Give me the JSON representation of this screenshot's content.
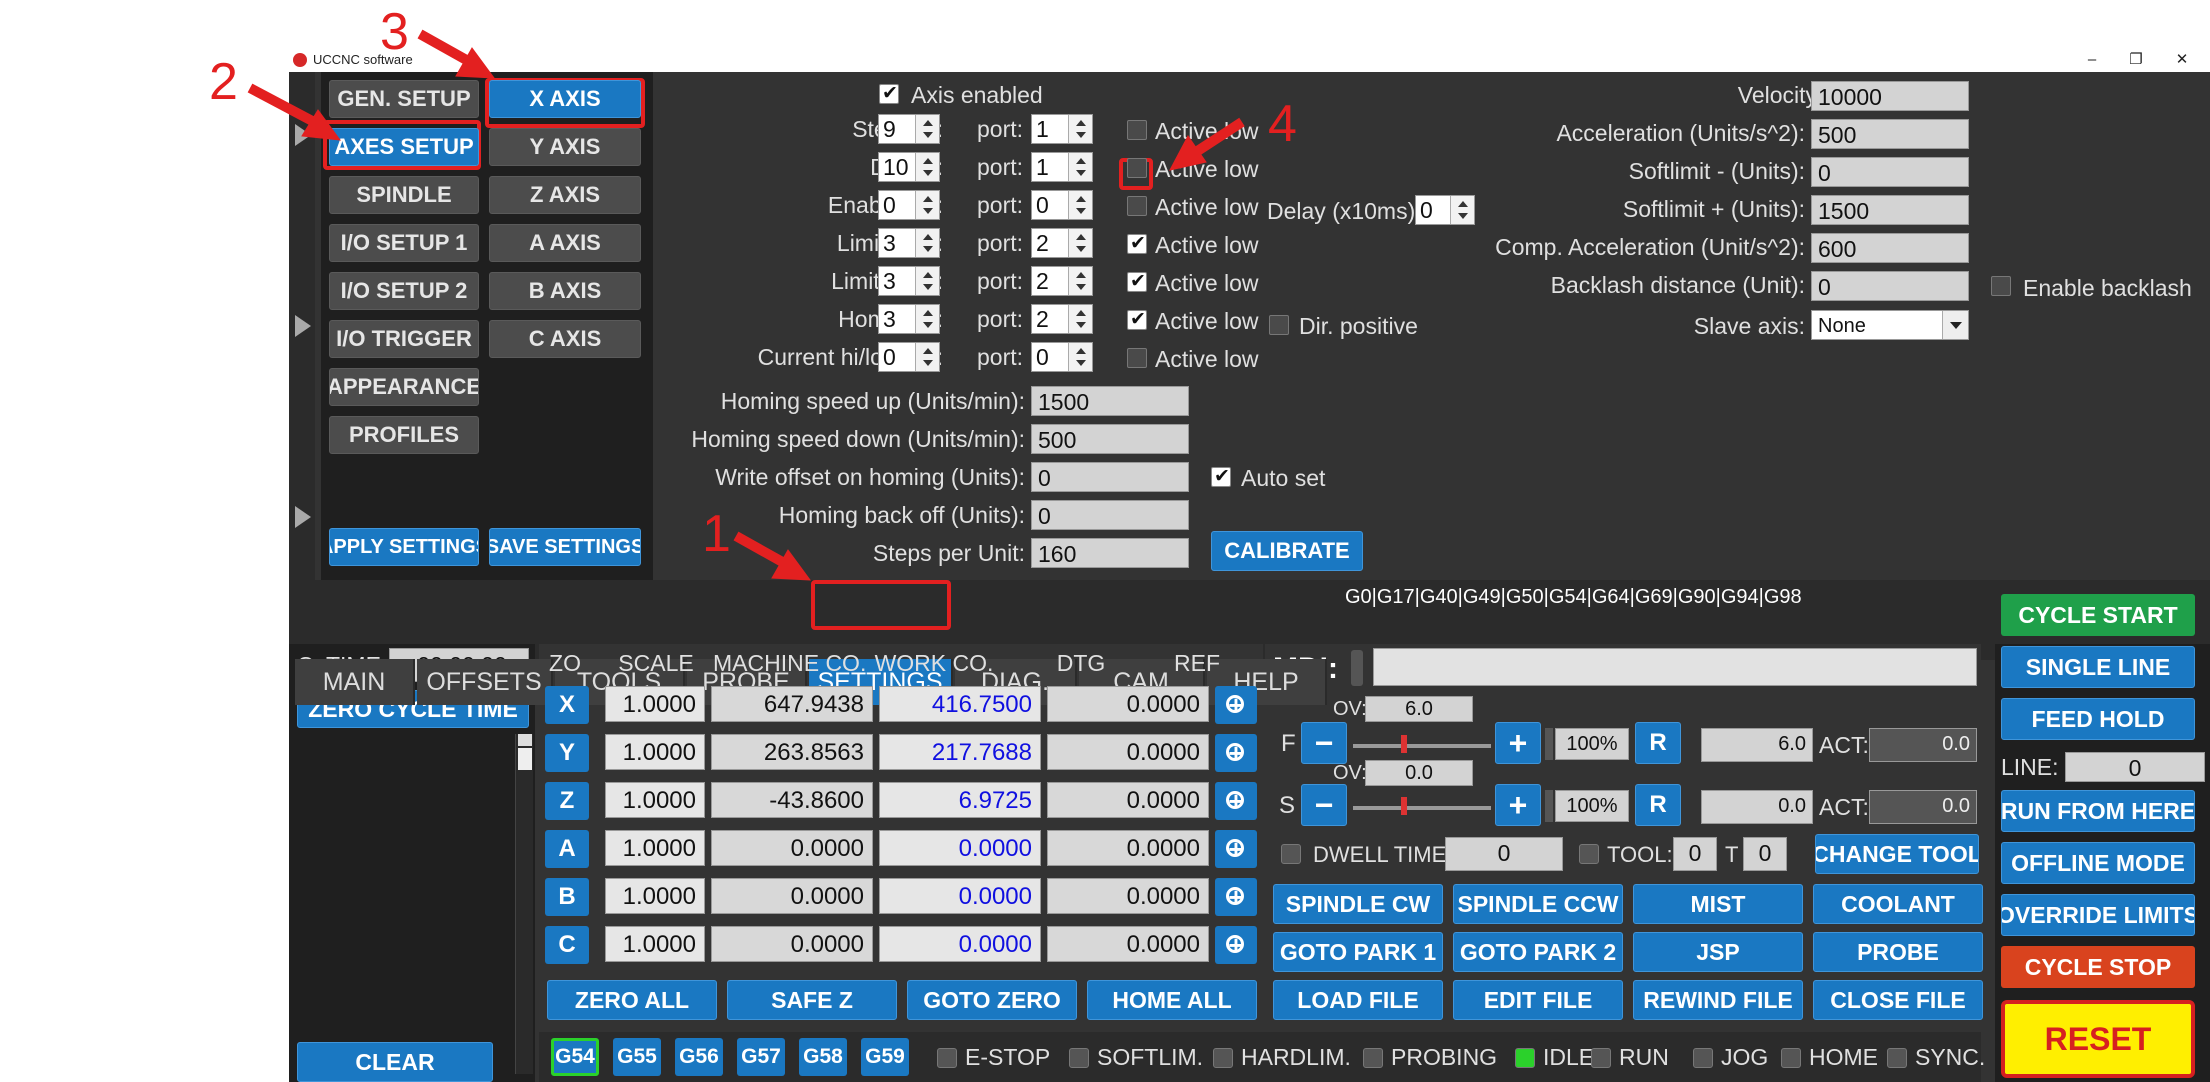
{
  "window": {
    "title": "UCCNC software",
    "min": "–",
    "restore": "❐",
    "close": "✕"
  },
  "annotations": {
    "n1": "1",
    "n2": "2",
    "n3": "3",
    "n4": "4"
  },
  "left_menu": {
    "items": [
      "GEN. SETUP",
      "AXES SETUP",
      "SPINDLE",
      "I/O SETUP 1",
      "I/O SETUP 2",
      "I/O TRIGGER",
      "APPEARANCE",
      "PROFILES"
    ],
    "apply": "APPLY SETTINGS",
    "save": "SAVE SETTINGS"
  },
  "axis_menu": {
    "items": [
      "X AXIS",
      "Y AXIS",
      "Z AXIS",
      "A AXIS",
      "B AXIS",
      "C AXIS"
    ]
  },
  "axis_cfg": {
    "enabled": "Axis enabled",
    "pins": [
      {
        "label": "Step pin:",
        "pin": "9",
        "port_label": "port:",
        "port": "1",
        "al": "Active low"
      },
      {
        "label": "Dir pin:",
        "pin": "10",
        "port_label": "port:",
        "port": "1",
        "al": "Active low"
      },
      {
        "label": "Enable pin:",
        "pin": "0",
        "port_label": "port:",
        "port": "0",
        "al": "Active low"
      },
      {
        "label": "Limit - pin:",
        "pin": "3",
        "port_label": "port:",
        "port": "2",
        "al": "Active low"
      },
      {
        "label": "Limit + pin:",
        "pin": "3",
        "port_label": "port:",
        "port": "2",
        "al": "Active low"
      },
      {
        "label": "Home pin:",
        "pin": "3",
        "port_label": "port:",
        "port": "2",
        "al": "Active low"
      },
      {
        "label": "Current hi/low pin:",
        "pin": "0",
        "port_label": "port:",
        "port": "0",
        "al": "Active low"
      }
    ],
    "delay_label": "Delay (x10ms):",
    "delay": "0",
    "dir_positive": "Dir. positive",
    "homing_up_label": "Homing speed up (Units/min):",
    "homing_up": "1500",
    "homing_down_label": "Homing speed down (Units/min):",
    "homing_down": "500",
    "write_offset_label": "Write offset on homing (Units):",
    "write_offset": "0",
    "auto_set": "Auto set",
    "backoff_label": "Homing back off (Units):",
    "backoff": "0",
    "steps_label": "Steps per Unit:",
    "steps": "160",
    "calibrate": "CALIBRATE",
    "velocity_label": "Velocity (Units/min):",
    "velocity": "10000",
    "accel_label": "Acceleration (Units/s^2):",
    "accel": "500",
    "softmin_label": "Softlimit - (Units):",
    "softmin": "0",
    "softmax_label": "Softlimit + (Units):",
    "softmax": "1500",
    "comp_label": "Comp. Acceleration (Unit/s^2):",
    "comp": "600",
    "backlash_label": "Backlash distance (Unit):",
    "backlash": "0",
    "enable_backlash": "Enable backlash",
    "slave_label": "Slave axis:",
    "slave": "None"
  },
  "tabs": [
    "MAIN",
    "OFFSETS",
    "TOOLS",
    "PROBE",
    "SETTINGS",
    "DIAG.",
    "CAM",
    "HELP"
  ],
  "gcode_state": "G0|G17|G40|G49|G50|G54|G64|G69|G90|G94|G98",
  "cycle": {
    "label": "C. TIME:",
    "value": "00:00:00",
    "zero": "ZERO CYCLE TIME",
    "clear": "CLEAR"
  },
  "dro": {
    "headers": [
      "ZO",
      "SCALE",
      "MACHINE CO.",
      "WORK CO.",
      "DTG",
      "REF"
    ],
    "rows": [
      {
        "axis": "X",
        "scale": "1.0000",
        "machine": "647.9438",
        "work": "416.7500",
        "dtg": "0.0000"
      },
      {
        "axis": "Y",
        "scale": "1.0000",
        "machine": "263.8563",
        "work": "217.7688",
        "dtg": "0.0000"
      },
      {
        "axis": "Z",
        "scale": "1.0000",
        "machine": "-43.8600",
        "work": "6.9725",
        "dtg": "0.0000"
      },
      {
        "axis": "A",
        "scale": "1.0000",
        "machine": "0.0000",
        "work": "0.0000",
        "dtg": "0.0000"
      },
      {
        "axis": "B",
        "scale": "1.0000",
        "machine": "0.0000",
        "work": "0.0000",
        "dtg": "0.0000"
      },
      {
        "axis": "C",
        "scale": "1.0000",
        "machine": "0.0000",
        "work": "0.0000",
        "dtg": "0.0000"
      }
    ],
    "buttons": [
      "ZERO ALL",
      "SAFE Z",
      "GOTO ZERO",
      "HOME ALL"
    ]
  },
  "mdi": {
    "label": "MDI:",
    "value": ""
  },
  "feed": {
    "letter": "F",
    "ov_label": "OV:",
    "ov": "6.0",
    "minus": "−",
    "plus": "+",
    "pct": "100%",
    "reset": "R",
    "value": "6.0",
    "act_label": "ACT:",
    "act": "0.0"
  },
  "spindle": {
    "letter": "S",
    "ov_label": "OV:",
    "ov": "0.0",
    "minus": "−",
    "plus": "+",
    "pct": "100%",
    "reset": "R",
    "value": "0.0",
    "act_label": "ACT:",
    "act": "0.0"
  },
  "dwell": {
    "label": "DWELL TIME:",
    "value": "0"
  },
  "tool": {
    "label": "TOOL:",
    "value": "0",
    "t_label": "T",
    "t_value": "0",
    "change": "CHANGE TOOL"
  },
  "cmd_buttons": [
    [
      "SPINDLE CW",
      "SPINDLE CCW",
      "MIST",
      "COOLANT"
    ],
    [
      "GOTO PARK 1",
      "GOTO PARK 2",
      "JSP",
      "PROBE"
    ],
    [
      "LOAD FILE",
      "EDIT FILE",
      "REWIND FILE",
      "CLOSE FILE"
    ]
  ],
  "right_buttons": {
    "cycle_start": "CYCLE START",
    "single_line": "SINGLE LINE",
    "feed_hold": "FEED HOLD",
    "line_label": "LINE:",
    "line": "0",
    "run_from_here": "RUN FROM HERE",
    "offline": "OFFLINE MODE",
    "override": "OVERRIDE LIMITS",
    "cycle_stop": "CYCLE STOP",
    "reset": "RESET"
  },
  "work_offsets": [
    "G54",
    "G55",
    "G56",
    "G57",
    "G58",
    "G59"
  ],
  "status": [
    {
      "label": "E-STOP",
      "on": false
    },
    {
      "label": "SOFTLIM.",
      "on": false
    },
    {
      "label": "HARDLIM.",
      "on": false
    },
    {
      "label": "PROBING",
      "on": false
    },
    {
      "label": "IDLE",
      "on": true
    },
    {
      "label": "RUN",
      "on": false
    },
    {
      "label": "JOG",
      "on": false
    },
    {
      "label": "HOME",
      "on": false
    },
    {
      "label": "SYNC.",
      "on": false
    }
  ],
  "colors": {
    "accent": "#1a78c2",
    "annotation": "#e32020",
    "work_co": "#1010e0",
    "reset_bg": "#ffef00"
  }
}
